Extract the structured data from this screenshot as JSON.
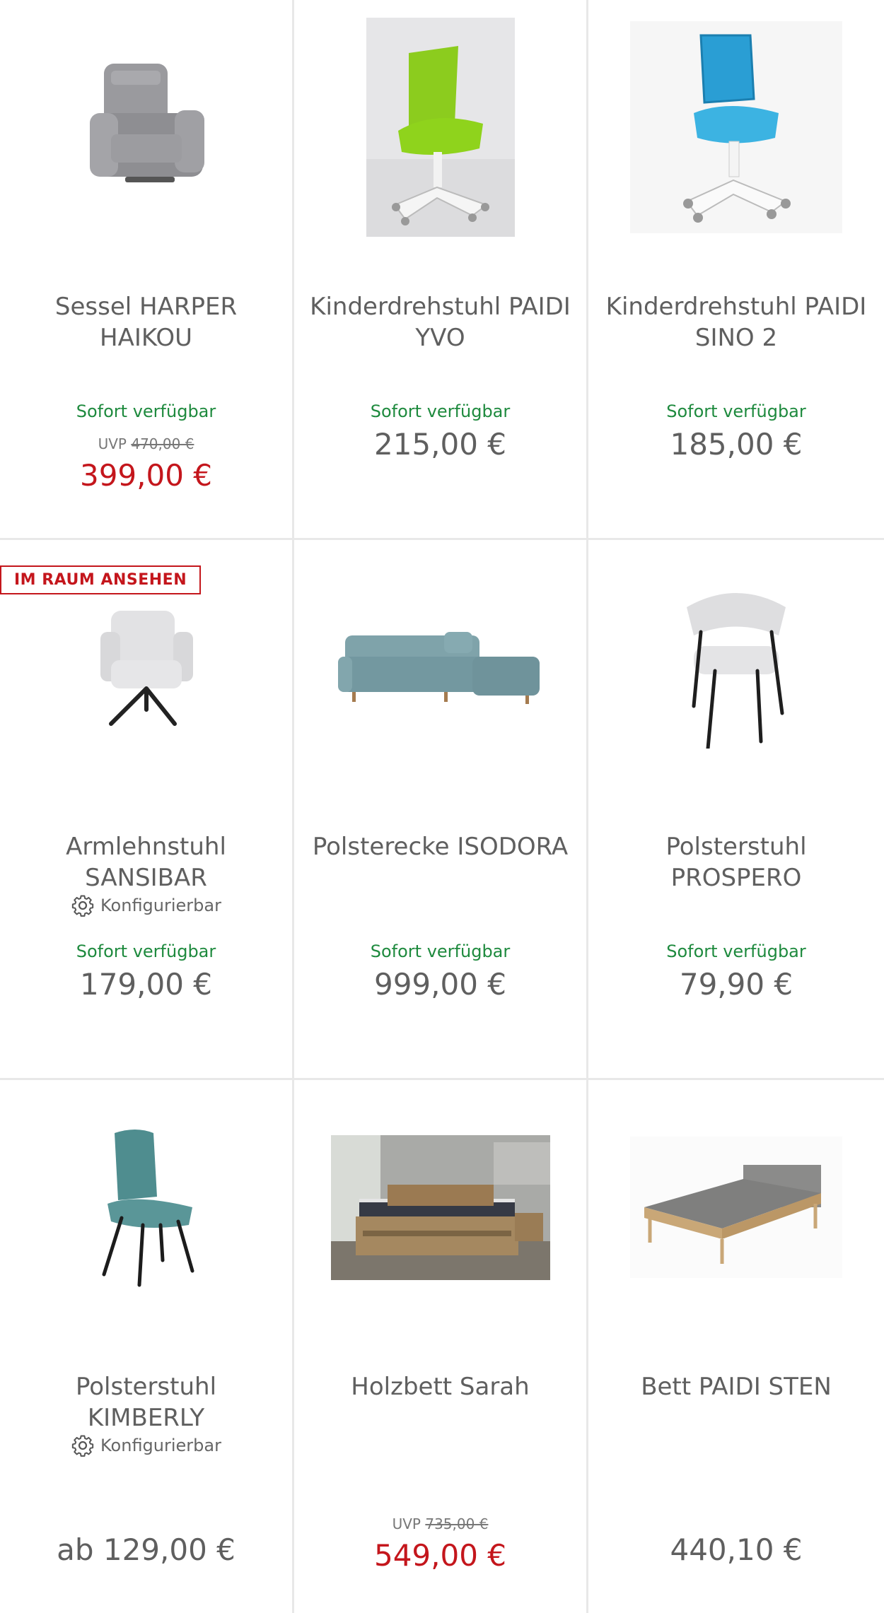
{
  "colors": {
    "availability": "#1e8a3e",
    "sale_price": "#c4161c",
    "badge": "#c4161c",
    "divider": "#e8e8e8"
  },
  "products": [
    {
      "title": "Sessel HARPER HAIKOU",
      "availability": "Sofort verfügbar",
      "uvp_label": "UVP",
      "uvp_price": "470,00 €",
      "price": "399,00 €",
      "image": "grey-recliner-armchair"
    },
    {
      "title": "Kinderdrehstuhl PAIDI YVO",
      "availability": "Sofort verfügbar",
      "price": "215,00 €",
      "image": "green-kids-desk-chair"
    },
    {
      "title": "Kinderdrehstuhl PAIDI SINO 2",
      "availability": "Sofort verfügbar",
      "price": "185,00 €",
      "image": "blue-kids-desk-chair"
    },
    {
      "badge": "IM RAUM ANSEHEN",
      "title": "Armlehnstuhl SANSIBAR",
      "config_label": "Konfigurierbar",
      "availability": "Sofort verfügbar",
      "price": "179,00 €",
      "image": "light-grey-swivel-armchair"
    },
    {
      "title": "Polsterecke ISODORA",
      "availability": "Sofort verfügbar",
      "price": "999,00 €",
      "image": "blue-grey-corner-sofa"
    },
    {
      "title": "Polsterstuhl PROSPERO",
      "availability": "Sofort verfügbar",
      "price": "79,90 €",
      "image": "white-dining-chair-black-legs"
    },
    {
      "title": "Polsterstuhl KIMBERLY",
      "config_label": "Konfigurierbar",
      "price": "ab 129,00 €",
      "image": "teal-dining-chair"
    },
    {
      "title": "Holzbett Sarah",
      "uvp_label": "UVP",
      "uvp_price": "735,00 €",
      "price": "549,00 €",
      "image": "wooden-bed-bedroom"
    },
    {
      "title": "Bett PAIDI STEN",
      "price": "440,10 €",
      "image": "oak-bed-grey-headboard"
    }
  ]
}
